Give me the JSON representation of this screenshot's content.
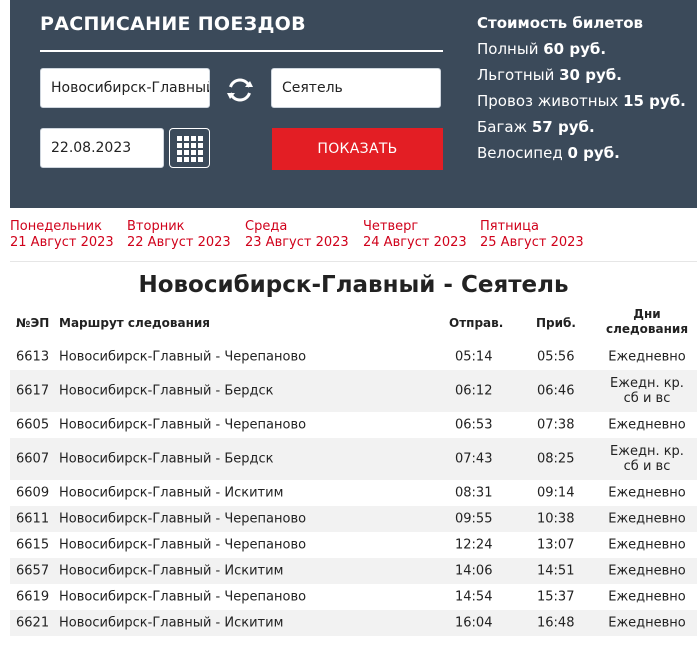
{
  "header": {
    "title": "РАСПИСАНИЕ ПОЕЗДОВ",
    "from_value": "Новосибирск-Главный",
    "to_value": "Сеятель",
    "date_value": "22.08.2023",
    "show_button": "ПОКАЗАТЬ"
  },
  "prices": {
    "title": "Стоимость билетов",
    "rows": [
      {
        "label": "Полный",
        "value": "60 руб."
      },
      {
        "label": "Льготный",
        "value": "30 руб."
      },
      {
        "label": "Провоз животных",
        "value": "15 руб."
      },
      {
        "label": "Багаж",
        "value": "57 руб."
      },
      {
        "label": "Велосипед",
        "value": "0 руб."
      }
    ]
  },
  "days": [
    {
      "name": "Понедельник",
      "date": "21 Август 2023"
    },
    {
      "name": "Вторник",
      "date": "22 Август 2023"
    },
    {
      "name": "Среда",
      "date": "23 Август 2023"
    },
    {
      "name": "Четверг",
      "date": "24 Август 2023"
    },
    {
      "name": "Пятница",
      "date": "25 Август 2023"
    }
  ],
  "route_title": "Новосибирск-Главный - Сеятель",
  "table": {
    "headers": {
      "num": "№ЭП",
      "route": "Маршрут следования",
      "dep": "Отправ.",
      "arr": "Приб.",
      "days": "Дни следования"
    },
    "rows": [
      {
        "num": "6613",
        "route": "Новосибирск-Главный - Черепаново",
        "dep": "05:14",
        "arr": "05:56",
        "days": "Ежедневно"
      },
      {
        "num": "6617",
        "route": "Новосибирск-Главный - Бердск",
        "dep": "06:12",
        "arr": "06:46",
        "days": "Ежедн. кр. сб и вс"
      },
      {
        "num": "6605",
        "route": "Новосибирск-Главный - Черепаново",
        "dep": "06:53",
        "arr": "07:38",
        "days": "Ежедневно"
      },
      {
        "num": "6607",
        "route": "Новосибирск-Главный - Бердск",
        "dep": "07:43",
        "arr": "08:25",
        "days": "Ежедн. кр. сб и вс"
      },
      {
        "num": "6609",
        "route": "Новосибирск-Главный - Искитим",
        "dep": "08:31",
        "arr": "09:14",
        "days": "Ежедневно"
      },
      {
        "num": "6611",
        "route": "Новосибирск-Главный - Черепаново",
        "dep": "09:55",
        "arr": "10:38",
        "days": "Ежедневно"
      },
      {
        "num": "6615",
        "route": "Новосибирск-Главный - Черепаново",
        "dep": "12:24",
        "arr": "13:07",
        "days": "Ежедневно"
      },
      {
        "num": "6657",
        "route": "Новосибирск-Главный - Искитим",
        "dep": "14:06",
        "arr": "14:51",
        "days": "Ежедневно"
      },
      {
        "num": "6619",
        "route": "Новосибирск-Главный - Черепаново",
        "dep": "14:54",
        "arr": "15:37",
        "days": "Ежедневно"
      },
      {
        "num": "6621",
        "route": "Новосибирск-Главный - Искитим",
        "dep": "16:04",
        "arr": "16:48",
        "days": "Ежедневно"
      }
    ]
  }
}
